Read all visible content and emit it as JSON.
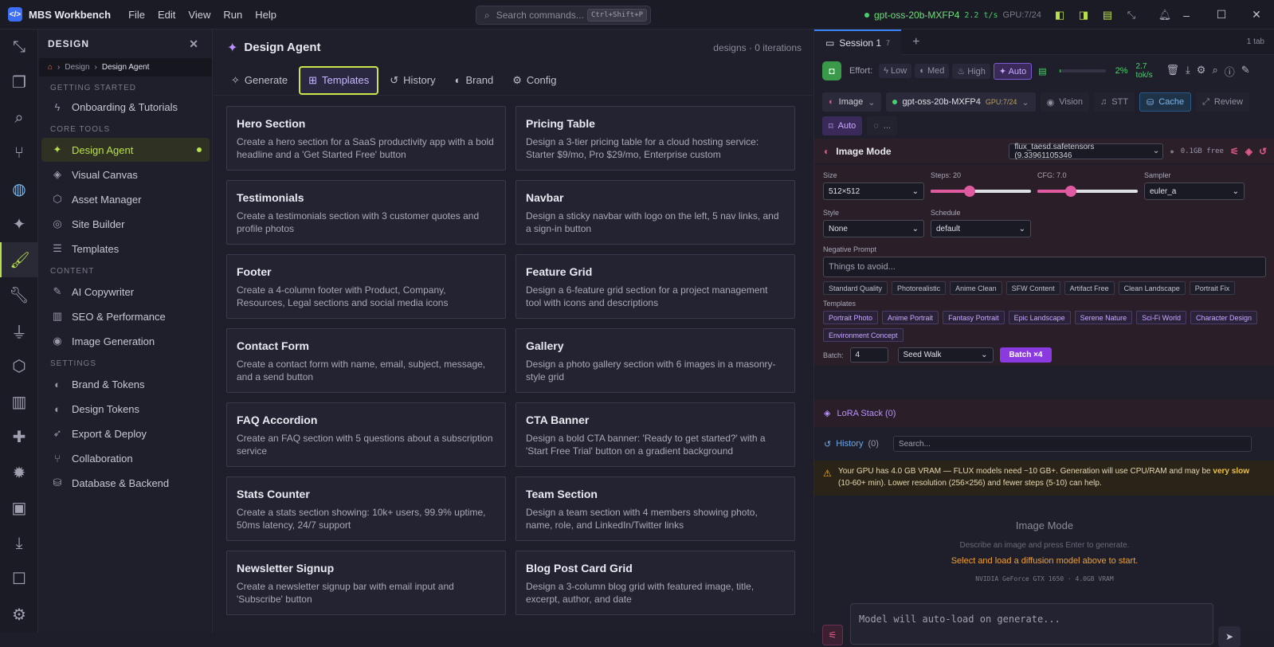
{
  "app": {
    "title": "MBS Workbench",
    "logo_glyph": "</>"
  },
  "menu": [
    "File",
    "Edit",
    "View",
    "Run",
    "Help"
  ],
  "command": {
    "placeholder": "Search commands...",
    "shortcut": "Ctrl+Shift+P"
  },
  "status": {
    "model": "gpt-oss-20b-MXFP4",
    "speed": "2.2 t/s",
    "gpu": "GPU:7/24"
  },
  "sidebar": {
    "title": "DESIGN",
    "breadcrumb": [
      "Design",
      "Design Agent"
    ],
    "sections": [
      {
        "title": "GETTING STARTED",
        "items": [
          {
            "label": "Onboarding & Tutorials",
            "icon": "bolt-icon"
          }
        ]
      },
      {
        "title": "CORE TOOLS",
        "items": [
          {
            "label": "Design Agent",
            "icon": "sparkle-icon",
            "active": true
          },
          {
            "label": "Visual Canvas",
            "icon": "layers-icon"
          },
          {
            "label": "Asset Manager",
            "icon": "box-icon"
          },
          {
            "label": "Site Builder",
            "icon": "globe-icon"
          },
          {
            "label": "Templates",
            "icon": "stack-icon"
          }
        ]
      },
      {
        "title": "CONTENT",
        "items": [
          {
            "label": "AI Copywriter",
            "icon": "pen-icon"
          },
          {
            "label": "SEO & Performance",
            "icon": "chart-icon"
          },
          {
            "label": "Image Generation",
            "icon": "eye-icon"
          }
        ]
      },
      {
        "title": "SETTINGS",
        "items": [
          {
            "label": "Brand & Tokens",
            "icon": "palette-icon"
          },
          {
            "label": "Design Tokens",
            "icon": "palette-icon"
          },
          {
            "label": "Export & Deploy",
            "icon": "rocket-icon"
          },
          {
            "label": "Collaboration",
            "icon": "branch-icon"
          },
          {
            "label": "Database & Backend",
            "icon": "database-icon"
          }
        ]
      }
    ]
  },
  "main": {
    "title": "Design Agent",
    "meta": "designs · 0 iterations",
    "tabs": [
      {
        "label": "Generate",
        "icon": "wand-icon"
      },
      {
        "label": "Templates",
        "icon": "grid-icon",
        "active": true
      },
      {
        "label": "History",
        "icon": "history-icon"
      },
      {
        "label": "Brand",
        "icon": "palette-icon"
      },
      {
        "label": "Config",
        "icon": "gear-icon"
      }
    ],
    "templates": [
      {
        "title": "Hero Section",
        "desc": "Create a hero section for a SaaS productivity app with a bold headline and a 'Get Started Free' button"
      },
      {
        "title": "Pricing Table",
        "desc": "Design a 3-tier pricing table for a cloud hosting service: Starter $9/mo, Pro $29/mo, Enterprise custom"
      },
      {
        "title": "Testimonials",
        "desc": "Create a testimonials section with 3 customer quotes and profile photos"
      },
      {
        "title": "Navbar",
        "desc": "Design a sticky navbar with logo on the left, 5 nav links, and a sign-in button"
      },
      {
        "title": "Footer",
        "desc": "Create a 4-column footer with Product, Company, Resources, Legal sections and social media icons"
      },
      {
        "title": "Feature Grid",
        "desc": "Design a 6-feature grid section for a project management tool with icons and descriptions"
      },
      {
        "title": "Contact Form",
        "desc": "Create a contact form with name, email, subject, message, and a send button"
      },
      {
        "title": "Gallery",
        "desc": "Design a photo gallery section with 6 images in a masonry-style grid"
      },
      {
        "title": "FAQ Accordion",
        "desc": "Create an FAQ section with 5 questions about a subscription service"
      },
      {
        "title": "CTA Banner",
        "desc": "Design a bold CTA banner: 'Ready to get started?' with a 'Start Free Trial' button on a gradient background"
      },
      {
        "title": "Stats Counter",
        "desc": "Create a stats section showing: 10k+ users, 99.9% uptime, 50ms latency, 24/7 support"
      },
      {
        "title": "Team Section",
        "desc": "Design a team section with 4 members showing photo, name, role, and LinkedIn/Twitter links"
      },
      {
        "title": "Newsletter Signup",
        "desc": "Create a newsletter signup bar with email input and 'Subscribe' button"
      },
      {
        "title": "Blog Post Card Grid",
        "desc": "Design a 3-column blog grid with featured image, title, excerpt, author, and date"
      }
    ]
  },
  "session": {
    "tab": "Session 1",
    "tab_count": "7",
    "tabs_info": "1 tab",
    "effort_label": "Effort:",
    "effort": [
      "Low",
      "Med",
      "High",
      "Auto"
    ],
    "progress_fraction": 0.02,
    "progress": "2%",
    "tok_rate": "2.7 tok/s",
    "mode": "Image",
    "model": "gpt-oss-20b-MXFP4",
    "model_gpu": "GPU:7/24",
    "toggles": [
      "Vision",
      "STT",
      "Cache",
      "Review"
    ],
    "auto": "Auto",
    "spinner": "..."
  },
  "image": {
    "title": "Image Mode",
    "model_file": "flux_taesd.safetensors (9.33961105346",
    "free": "0.1GB free",
    "size_label": "Size",
    "size": "512×512",
    "steps_label": "Steps: 20",
    "steps_fraction": 0.39,
    "cfg_label": "CFG: 7.0",
    "cfg_fraction": 0.33,
    "sampler_label": "Sampler",
    "sampler": "euler_a",
    "style_label": "Style",
    "style": "None",
    "schedule_label": "Schedule",
    "schedule": "default",
    "neg_label": "Negative Prompt",
    "neg_placeholder": "Things to avoid...",
    "neg_tags": [
      "Standard Quality",
      "Photorealistic",
      "Anime Clean",
      "SFW Content",
      "Artifact Free",
      "Clean Landscape",
      "Portrait Fix"
    ],
    "templates_label": "Templates",
    "templates": [
      "Portrait Photo",
      "Anime Portrait",
      "Fantasy Portrait",
      "Epic Landscape",
      "Serene Nature",
      "Sci-Fi World",
      "Character Design",
      "Environment Concept"
    ],
    "batch_label": "Batch:",
    "batch": "4",
    "seed": "Seed Walk",
    "batch_button": "Batch ×4",
    "lora": "LoRA Stack (0)",
    "history": "History",
    "history_count": "(0)",
    "history_placeholder": "Search...",
    "warn_pre": "Your GPU has 4.0 GB VRAM — FLUX models need ~10 GB+. Generation will use CPU/RAM and may be",
    "warn_bold": "very slow",
    "warn_post": "(10-60+ min). Lower resolution (256×256) and fewer steps (5-10) can help.",
    "empty_title": "Image Mode",
    "empty_desc": "Describe an image and press Enter to generate.",
    "empty_orange": "Select and load a diffusion model above to start.",
    "gpu": "NVIDIA GeForce GTX 1650 · 4.0GB VRAM",
    "composer_placeholder": "Model will auto-load on generate..."
  }
}
